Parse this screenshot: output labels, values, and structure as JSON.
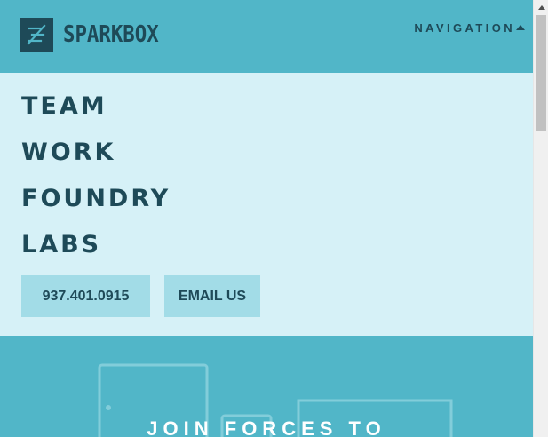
{
  "header": {
    "logo_text": "SPARKBOX",
    "nav_label": "NAVIGATION"
  },
  "menu": {
    "items": [
      {
        "label": "TEAM"
      },
      {
        "label": "WORK"
      },
      {
        "label": "FOUNDRY"
      },
      {
        "label": "LABS"
      }
    ],
    "phone_label": "937.401.0915",
    "email_label": "EMAIL US"
  },
  "hero": {
    "title": "JOIN FORCES TO"
  },
  "colors": {
    "brand_dark": "#1e4a58",
    "header_bg": "#51b6c8",
    "menu_bg": "#d6f1f7",
    "button_bg": "#a2dce7"
  },
  "icons": {
    "logo": "sparkbox-logo-icon",
    "nav_caret": "caret-up-icon"
  }
}
